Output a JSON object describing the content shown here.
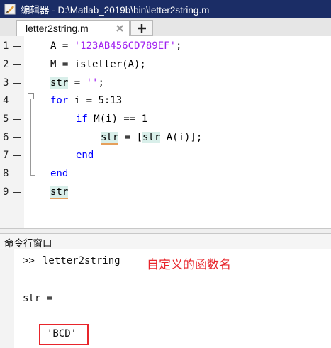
{
  "window": {
    "title": "编辑器 - D:\\Matlab_2019b\\bin\\letter2string.m"
  },
  "tabs": [
    {
      "label": "letter2string.m"
    }
  ],
  "editor": {
    "lines": [
      {
        "num": "1",
        "text": "A = '123AB456CD789EF';"
      },
      {
        "num": "2",
        "text": "M = isletter(A);"
      },
      {
        "num": "3",
        "text": "str = '';"
      },
      {
        "num": "4",
        "text": "for i = 5:13"
      },
      {
        "num": "5",
        "text": "if M(i) == 1"
      },
      {
        "num": "6",
        "text": "str = [str A(i)];"
      },
      {
        "num": "7",
        "text": "end"
      },
      {
        "num": "8",
        "text": "end"
      },
      {
        "num": "9",
        "text": "str"
      }
    ],
    "tokens": {
      "A": "A",
      "eq": " = ",
      "str_literal": "'123AB456CD789EF'",
      "semicolon": ";",
      "line2": "M = isletter(A);",
      "str": "str",
      "empty_str": "''",
      "for_kw": "for",
      "for_rest": " i = 5:13",
      "if_kw": "if",
      "if_rest": " M(i) == 1",
      "bracket_open": " = [",
      "line6_rest": " A(i)];",
      "end_kw": "end"
    }
  },
  "command_window": {
    "title": "命令行窗口",
    "prompt": ">>",
    "command": "letter2string",
    "output_var": "str =",
    "output_value": "'BCD'",
    "annotation": "自定义的函数名"
  },
  "colors": {
    "keyword": "#0000ff",
    "string": "#a020f0",
    "annotation": "#e8252b",
    "titlebar": "#1b2d66"
  }
}
